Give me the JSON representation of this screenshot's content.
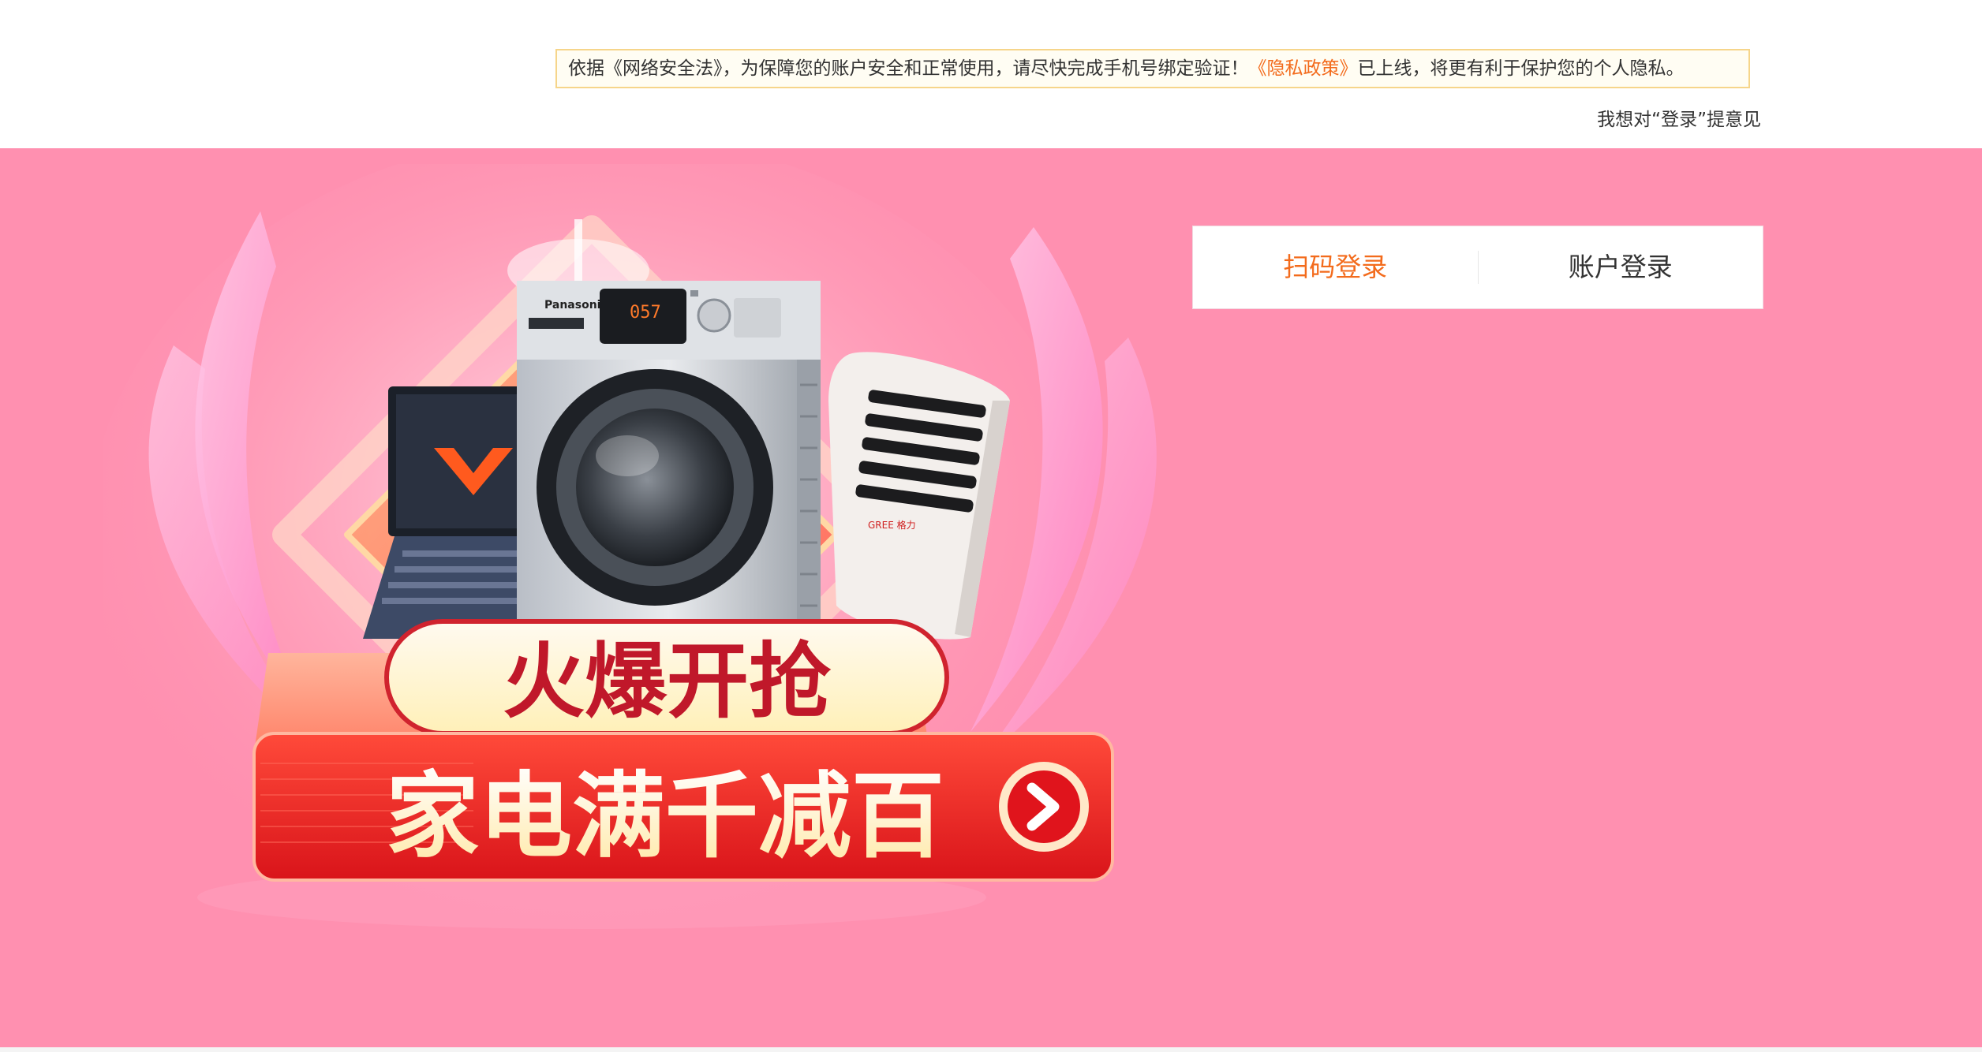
{
  "notice": {
    "text_before": "依据《网络安全法》，为保障您的账户安全和正常使用，请尽快完成手机号绑定验证！",
    "privacy_link": "《隐私政策》",
    "text_after": "已上线，将更有利于保护您的个人隐私。"
  },
  "feedback": {
    "label": "我想对“登录”提意见"
  },
  "promo": {
    "washer_brand": "Panasonic",
    "washer_display": "057",
    "ac_brand": "GREE 格力",
    "headline": "火爆开抢",
    "subheadline": "家电满千减百"
  },
  "login": {
    "tabs": [
      {
        "label": "扫码登录",
        "active": true
      },
      {
        "label": "账户登录",
        "active": false
      }
    ]
  },
  "colors": {
    "banner_bg": "#ff90b0",
    "accent_orange": "#f36b1c",
    "headline_red": "#c0182a",
    "cta_red": "#e8261e",
    "notice_border": "#f6d58a"
  },
  "icons": {
    "cta_arrow": "chevron-right-icon"
  }
}
